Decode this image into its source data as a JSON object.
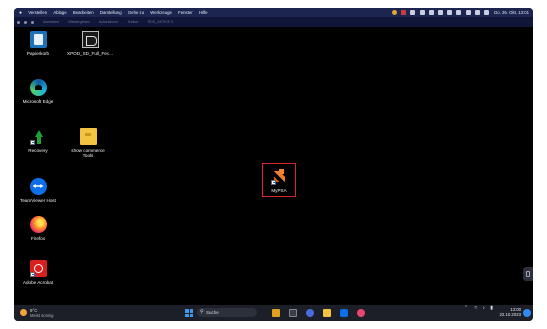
{
  "menubar": {
    "items": [
      "Verstellen",
      "Ablage",
      "Bearbeiten",
      "Darstellung",
      "Gehe zu",
      "Werkzeuge",
      "Fenster",
      "Hilfe"
    ],
    "datetime": "Do. 26. Okt. 13:01"
  },
  "rd_toolbar": {
    "items": [
      "Anmelden",
      "Wiedergeben",
      "Aufzeichnen",
      "Treiber",
      "RDS_AKTIVE S"
    ]
  },
  "desktop": {
    "icons": [
      {
        "label": "Papierkorb",
        "icon": "recycle-bin-icon"
      },
      {
        "label": "XPOD_SD_Full_Fec...",
        "icon": "skate-app-icon"
      },
      {
        "label": "Microsoft Edge",
        "icon": "edge-icon"
      },
      {
        "label": "Recovery",
        "icon": "recovery-arrow-icon"
      },
      {
        "label": "show commerce Tools",
        "icon": "folder-icon"
      },
      {
        "label": "TeamViewer Host",
        "icon": "teamviewer-icon"
      },
      {
        "label": "Firefox",
        "icon": "firefox-icon"
      },
      {
        "label": "Adobe Acrobat",
        "icon": "acrobat-icon"
      },
      {
        "label": "MyPSA",
        "icon": "mypsa-icon"
      }
    ]
  },
  "taskbar": {
    "weather_temp": "9°C",
    "weather_desc": "Meist sonnig",
    "search_placeholder": "Suche",
    "time": "13:00",
    "date": "22.10.2023",
    "pinned_apps": [
      "file-explorer-icon",
      "terminal-icon",
      "chat-icon",
      "folder-icon",
      "teamviewer-icon",
      "paint-icon"
    ]
  },
  "colors": {
    "menubar_bg": "#1b2550",
    "desktop_bg": "#000000",
    "taskbar_bg": "#1c1f27",
    "selection_border": "#d6282a",
    "accent": "#3b9af0"
  }
}
